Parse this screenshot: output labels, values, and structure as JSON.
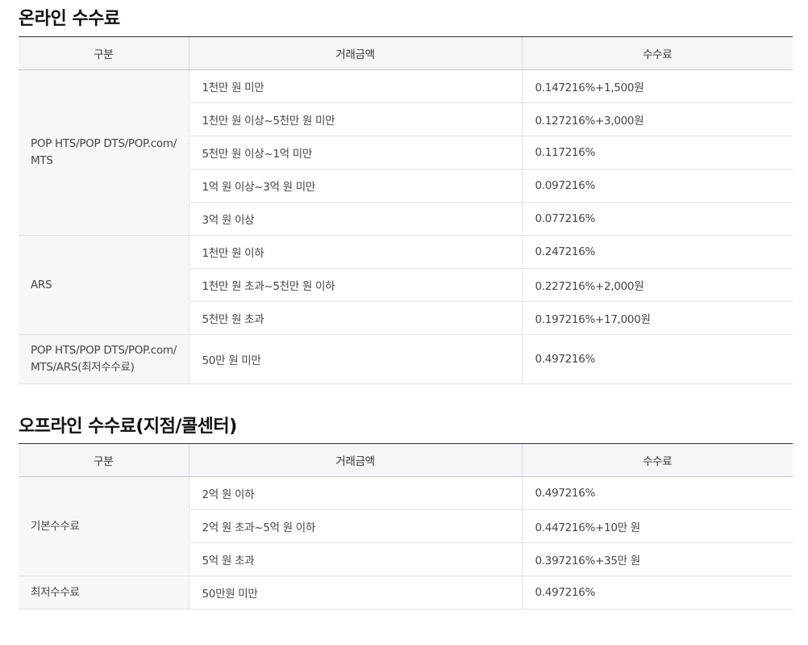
{
  "online": {
    "title": "온라인 수수료",
    "headers": [
      "구분",
      "거래금액",
      "수수료"
    ],
    "groups": [
      {
        "category": "POP HTS/POP DTS/POP.com/ MTS",
        "rows": [
          {
            "amount": "1천만 원 미만",
            "fee": "0.147216%+1,500원"
          },
          {
            "amount": "1천만 원 이상~5천만 원 미만",
            "fee": "0.127216%+3,000원"
          },
          {
            "amount": "5천만 원 이상~1억 미만",
            "fee": "0.117216%"
          },
          {
            "amount": "1억 원 이상~3억 원 미만",
            "fee": "0.097216%"
          },
          {
            "amount": "3억 원 이상",
            "fee": "0.077216%"
          }
        ]
      },
      {
        "category": "ARS",
        "rows": [
          {
            "amount": "1천만 원 이하",
            "fee": "0.247216%"
          },
          {
            "amount": "1천만 원 초과~5천만 원 이하",
            "fee": "0.227216%+2,000원"
          },
          {
            "amount": "5천만 원 초과",
            "fee": "0.197216%+17,000원"
          }
        ]
      },
      {
        "category": "POP HTS/POP DTS/POP.com/ MTS/ARS(최저수수료)",
        "rows": [
          {
            "amount": "50만 원 미만",
            "fee": "0.497216%"
          }
        ]
      }
    ]
  },
  "offline": {
    "title": "오프라인 수수료(지점/콜센터)",
    "headers": [
      "구분",
      "거래금액",
      "수수료"
    ],
    "groups": [
      {
        "category": "기본수수료",
        "rows": [
          {
            "amount": "2억 원 이하",
            "fee": "0.497216%"
          },
          {
            "amount": "2억 원 초과~5억 원 이하",
            "fee": "0.447216%+10만 원"
          },
          {
            "amount": "5억 원 초과",
            "fee": "0.397216%+35만 원"
          }
        ]
      },
      {
        "category": "최저수수료",
        "rows": [
          {
            "amount": "50만원 미만",
            "fee": "0.497216%"
          }
        ]
      }
    ]
  }
}
